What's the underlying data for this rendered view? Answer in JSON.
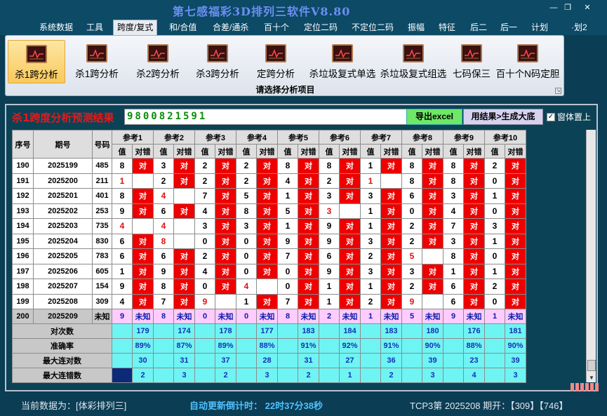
{
  "app": {
    "title": "第七感福彩3D排列三软件V8.80"
  },
  "menu": [
    "系统数据",
    "工具",
    "跨度/复式",
    "和/合值",
    "合差/通杀",
    "百十个",
    "定位二码",
    "不定位二码",
    "振幅",
    "特征",
    "后二",
    "后一",
    "计划",
    "·划2"
  ],
  "menu_active": 2,
  "ribbon": {
    "tools": [
      {
        "label": "杀1跨分析",
        "icon": "chart-icon"
      },
      {
        "label": "杀1跨分析",
        "icon": "chart-icon"
      },
      {
        "label": "杀2跨分析",
        "icon": "chart-icon"
      },
      {
        "label": "杀3跨分析",
        "icon": "chart-icon"
      },
      {
        "label": "定跨分析",
        "icon": "chart-icon"
      },
      {
        "label": "杀垃圾复式单选",
        "icon": "chart-icon"
      },
      {
        "label": "杀垃圾复式组选",
        "icon": "chart-icon"
      },
      {
        "label": "七码保三",
        "icon": "chart-icon"
      },
      {
        "label": "百十个N码定胆",
        "icon": "chart-icon"
      }
    ],
    "group_label": "请选择分析项目"
  },
  "result": {
    "title": "杀1跨度分析预测结果",
    "value": "9800821591",
    "btn_excel": "导出excel",
    "btn_export": "用结果>生成大底",
    "checkbox_label": "窗体置上"
  },
  "table": {
    "headers": {
      "seq": "序号",
      "period": "期号",
      "code": "号码",
      "ref_prefix": "参考",
      "val": "值",
      "check": "对错"
    },
    "right_mark": "对",
    "rows": [
      {
        "seq": "190",
        "period": "2025199",
        "code": "485",
        "cells": [
          [
            8,
            1
          ],
          [
            3,
            1
          ],
          [
            2,
            1
          ],
          [
            2,
            1
          ],
          [
            8,
            1
          ],
          [
            8,
            1
          ],
          [
            1,
            1
          ],
          [
            8,
            1
          ],
          [
            8,
            1
          ],
          [
            2,
            1
          ]
        ]
      },
      {
        "seq": "191",
        "period": "2025200",
        "code": "211",
        "cells": [
          [
            1,
            0
          ],
          [
            2,
            1
          ],
          [
            2,
            1
          ],
          [
            2,
            1
          ],
          [
            4,
            1
          ],
          [
            2,
            1
          ],
          [
            1,
            0
          ],
          [
            8,
            1
          ],
          [
            8,
            1
          ],
          [
            0,
            1
          ]
        ]
      },
      {
        "seq": "192",
        "period": "2025201",
        "code": "401",
        "cells": [
          [
            8,
            1
          ],
          [
            4,
            0
          ],
          [
            7,
            1
          ],
          [
            5,
            1
          ],
          [
            1,
            1
          ],
          [
            3,
            1
          ],
          [
            3,
            1
          ],
          [
            6,
            1
          ],
          [
            3,
            1
          ],
          [
            1,
            1
          ]
        ]
      },
      {
        "seq": "193",
        "period": "2025202",
        "code": "253",
        "cells": [
          [
            9,
            1
          ],
          [
            6,
            1
          ],
          [
            4,
            1
          ],
          [
            8,
            1
          ],
          [
            5,
            1
          ],
          [
            3,
            0
          ],
          [
            1,
            1
          ],
          [
            0,
            1
          ],
          [
            4,
            1
          ],
          [
            0,
            1
          ]
        ]
      },
      {
        "seq": "194",
        "period": "2025203",
        "code": "735",
        "cells": [
          [
            4,
            0
          ],
          [
            4,
            0
          ],
          [
            3,
            1
          ],
          [
            3,
            1
          ],
          [
            1,
            1
          ],
          [
            9,
            1
          ],
          [
            1,
            1
          ],
          [
            2,
            1
          ],
          [
            7,
            1
          ],
          [
            3,
            1
          ]
        ]
      },
      {
        "seq": "195",
        "period": "2025204",
        "code": "830",
        "cells": [
          [
            6,
            1
          ],
          [
            8,
            0
          ],
          [
            0,
            1
          ],
          [
            0,
            1
          ],
          [
            9,
            1
          ],
          [
            9,
            1
          ],
          [
            3,
            1
          ],
          [
            2,
            1
          ],
          [
            3,
            1
          ],
          [
            1,
            1
          ]
        ]
      },
      {
        "seq": "196",
        "period": "2025205",
        "code": "783",
        "cells": [
          [
            6,
            1
          ],
          [
            6,
            1
          ],
          [
            2,
            1
          ],
          [
            0,
            1
          ],
          [
            7,
            1
          ],
          [
            6,
            1
          ],
          [
            2,
            1
          ],
          [
            5,
            0
          ],
          [
            8,
            1
          ],
          [
            0,
            1
          ]
        ]
      },
      {
        "seq": "197",
        "period": "2025206",
        "code": "605",
        "cells": [
          [
            1,
            1
          ],
          [
            9,
            1
          ],
          [
            4,
            1
          ],
          [
            0,
            1
          ],
          [
            0,
            1
          ],
          [
            9,
            1
          ],
          [
            3,
            1
          ],
          [
            3,
            1
          ],
          [
            1,
            1
          ],
          [
            1,
            1
          ]
        ]
      },
      {
        "seq": "198",
        "period": "2025207",
        "code": "154",
        "cells": [
          [
            9,
            1
          ],
          [
            8,
            1
          ],
          [
            0,
            1
          ],
          [
            4,
            0
          ],
          [
            0,
            1
          ],
          [
            1,
            1
          ],
          [
            1,
            1
          ],
          [
            2,
            1
          ],
          [
            6,
            1
          ],
          [
            2,
            1
          ]
        ]
      },
      {
        "seq": "199",
        "period": "2025208",
        "code": "309",
        "cells": [
          [
            4,
            1
          ],
          [
            7,
            1
          ],
          [
            9,
            0
          ],
          [
            1,
            1
          ],
          [
            7,
            1
          ],
          [
            1,
            1
          ],
          [
            2,
            1
          ],
          [
            9,
            0
          ],
          [
            6,
            1
          ],
          [
            0,
            1
          ]
        ]
      }
    ],
    "pending_row": {
      "seq": "200",
      "period": "2025209",
      "code": "未知",
      "vals": [
        9,
        8,
        0,
        0,
        8,
        2,
        1,
        5,
        9,
        1
      ],
      "unknown": "未知"
    },
    "stats": [
      {
        "label": "对次数",
        "vals": [
          "179",
          "174",
          "178",
          "177",
          "183",
          "184",
          "183",
          "180",
          "176",
          "181"
        ]
      },
      {
        "label": "准确率",
        "vals": [
          "89%",
          "87%",
          "89%",
          "88%",
          "91%",
          "92%",
          "91%",
          "90%",
          "88%",
          "90%"
        ]
      },
      {
        "label": "最大连对数",
        "vals": [
          "30",
          "31",
          "37",
          "28",
          "31",
          "27",
          "36",
          "39",
          "23",
          "39"
        ]
      },
      {
        "label": "最大连错数",
        "vals": [
          "2",
          "3",
          "2",
          "3",
          "2",
          "1",
          "2",
          "3",
          "4",
          "3"
        ]
      }
    ]
  },
  "status": {
    "current_data": "当前数据为：[体彩排列三]",
    "countdown": "自动更新倒计时：  22时37分38秒",
    "latest": "TCP3第 2025208 期开：【309】【746】"
  },
  "colors": {
    "accent": "#6c8ff2",
    "wrong": "#e01010",
    "right": "#ef0000",
    "cyan": "#6ff4f4",
    "pink": "#ffccff"
  }
}
